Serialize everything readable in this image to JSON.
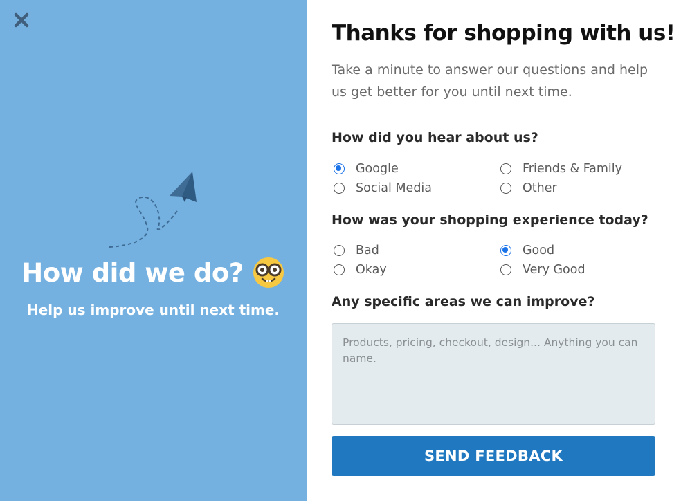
{
  "left": {
    "title": "How did we do?",
    "subtitle": "Help us improve until next time.",
    "emoji": "nerd-face-icon",
    "illustration": "paper-plane-icon",
    "close_icon": "close-icon",
    "background_color": "#75b1e0"
  },
  "right": {
    "title": "Thanks for shopping with us!",
    "intro": "Take a minute to answer our questions and help us get better for you until next time.",
    "q1": {
      "label": "How did you hear about us?",
      "options": [
        "Google",
        "Friends & Family",
        "Social Media",
        "Other"
      ],
      "selected": "Google"
    },
    "q2": {
      "label": "How was your shopping experience today?",
      "options": [
        "Bad",
        "Good",
        "Okay",
        "Very Good"
      ],
      "selected": "Good"
    },
    "q3": {
      "label": "Any specific areas we can improve?",
      "placeholder": "Products, pricing, checkout, design... Anything you can name."
    },
    "submit_label": "SEND FEEDBACK"
  },
  "colors": {
    "accent": "#2079c0",
    "radio_checked": "#1a73e8",
    "textarea_bg": "#e4ebee"
  }
}
